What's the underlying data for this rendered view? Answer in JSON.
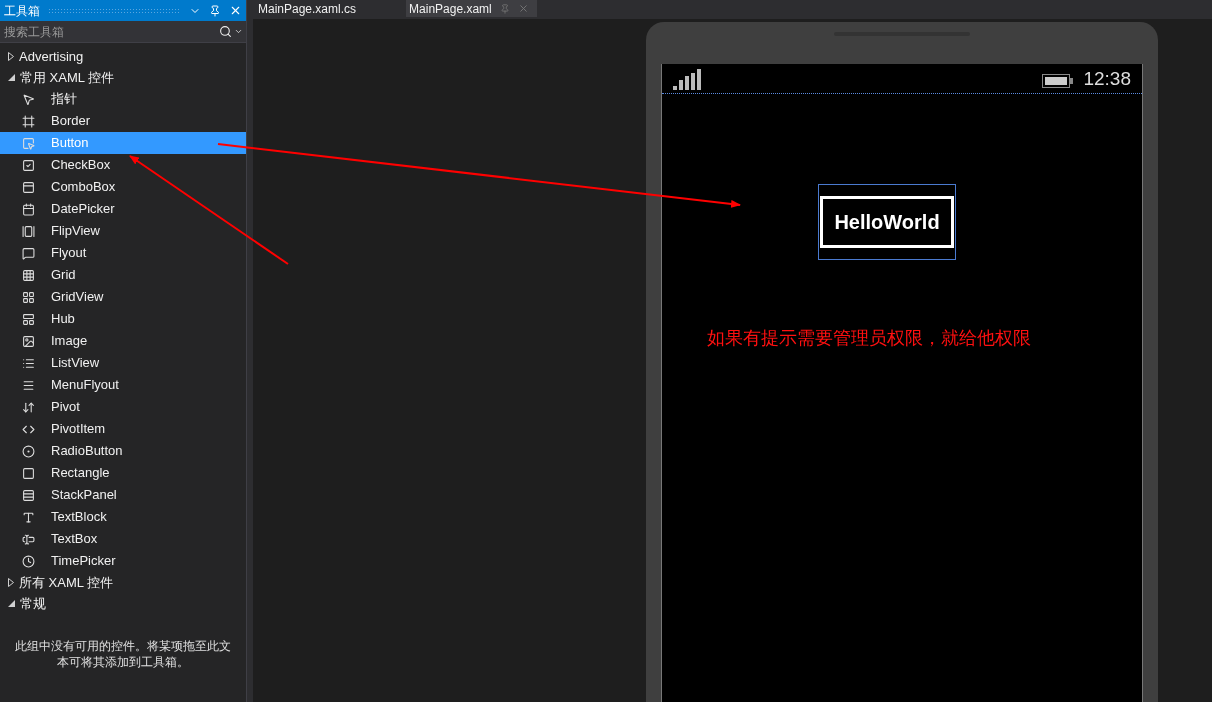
{
  "toolbox": {
    "title": "工具箱",
    "search": {
      "placeholder": "搜索工具箱"
    },
    "groups": [
      {
        "label": "Advertising",
        "expanded": false
      },
      {
        "label": "常用 XAML 控件",
        "expanded": true,
        "items": [
          {
            "label": "指针",
            "selected": false
          },
          {
            "label": "Border",
            "selected": false
          },
          {
            "label": "Button",
            "selected": true
          },
          {
            "label": "CheckBox",
            "selected": false
          },
          {
            "label": "ComboBox",
            "selected": false
          },
          {
            "label": "DatePicker",
            "selected": false
          },
          {
            "label": "FlipView",
            "selected": false
          },
          {
            "label": "Flyout",
            "selected": false
          },
          {
            "label": "Grid",
            "selected": false
          },
          {
            "label": "GridView",
            "selected": false
          },
          {
            "label": "Hub",
            "selected": false
          },
          {
            "label": "Image",
            "selected": false
          },
          {
            "label": "ListView",
            "selected": false
          },
          {
            "label": "MenuFlyout",
            "selected": false
          },
          {
            "label": "Pivot",
            "selected": false
          },
          {
            "label": "PivotItem",
            "selected": false
          },
          {
            "label": "RadioButton",
            "selected": false
          },
          {
            "label": "Rectangle",
            "selected": false
          },
          {
            "label": "StackPanel",
            "selected": false
          },
          {
            "label": "TextBlock",
            "selected": false
          },
          {
            "label": "TextBox",
            "selected": false
          },
          {
            "label": "TimePicker",
            "selected": false
          }
        ]
      },
      {
        "label": "所有 XAML 控件",
        "expanded": false
      },
      {
        "label": "常规",
        "expanded": true
      }
    ],
    "empty_message": "此组中没有可用的控件。将某项拖至此文本可将其添加到工具箱。"
  },
  "tabs": [
    {
      "label": "MainPage.xaml.cs",
      "selected": false
    },
    {
      "label": "MainPage.xaml",
      "selected": true
    }
  ],
  "phone": {
    "time": "12:38",
    "button_label": "HelloWorld"
  },
  "annotation": "如果有提示需要管理员权限，就给他权限"
}
